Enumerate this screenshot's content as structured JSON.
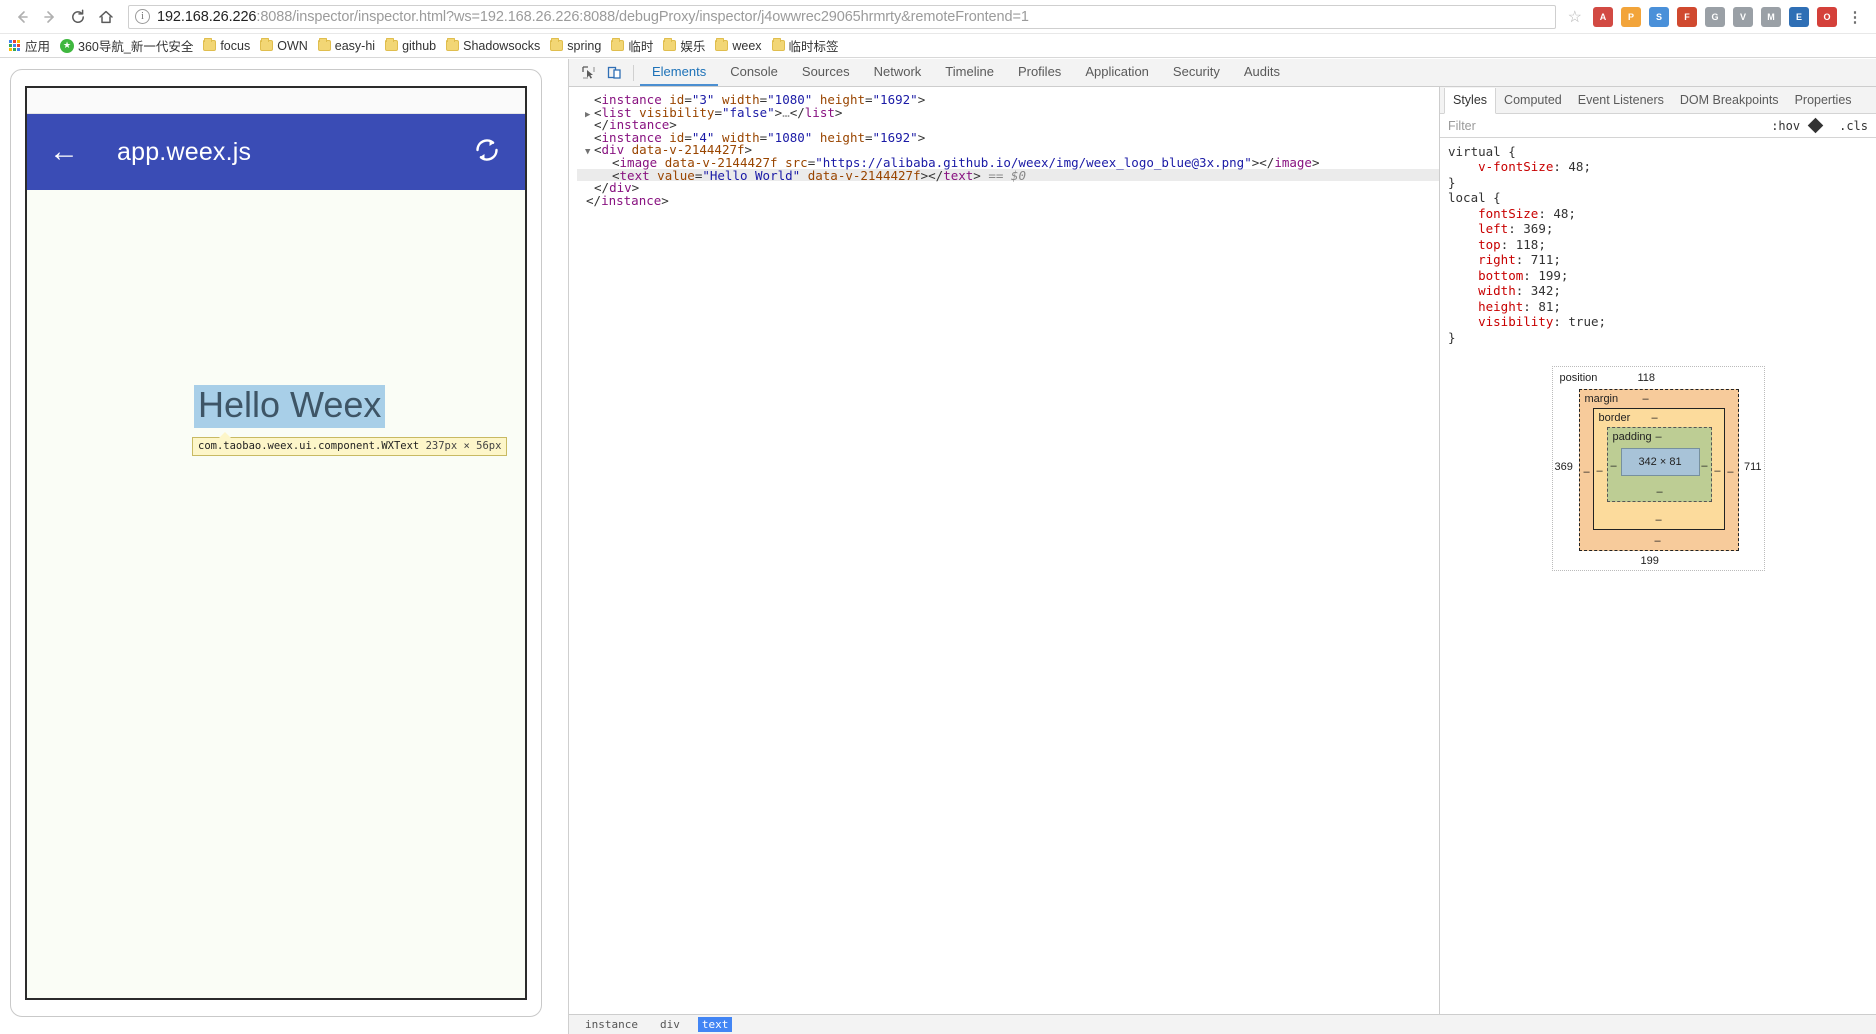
{
  "browser": {
    "nav": {
      "back_icon": "arrow-left-icon",
      "forward_icon": "arrow-right-icon",
      "reload_icon": "reload-icon",
      "home_icon": "home-icon"
    },
    "omnibox": {
      "info_icon": "info-icon",
      "host": "192.168.26.226",
      "path": ":8088/inspector/inspector.html?ws=192.168.26.226:8088/debugProxy/inspector/j4owwrec29065hrmrty&remoteFrontend=1",
      "star_icon": "star-icon"
    },
    "extensions": [
      {
        "name": "extension-icon-1",
        "label": "A",
        "color": "#d24a43"
      },
      {
        "name": "extension-icon-2",
        "label": "P",
        "color": "#f2a43a"
      },
      {
        "name": "extension-icon-3",
        "label": "S",
        "color": "#4a90d9"
      },
      {
        "name": "extension-icon-4",
        "label": "F",
        "color": "#d0492f"
      },
      {
        "name": "extension-icon-5",
        "label": "G",
        "color": "#9aa0a6"
      },
      {
        "name": "extension-icon-6",
        "label": "V",
        "color": "#9aa0a6"
      },
      {
        "name": "extension-icon-7",
        "label": "M",
        "color": "#9aa0a6"
      },
      {
        "name": "extension-icon-8",
        "label": "E",
        "color": "#2f6fb5"
      },
      {
        "name": "extension-icon-9",
        "label": "O",
        "color": "#d4403a"
      },
      {
        "name": "menu-icon",
        "label": "⋮",
        "color": "#6f6f6f"
      }
    ],
    "bookmarks": [
      {
        "label": "应用",
        "icon": "apps-grid-icon"
      },
      {
        "label": "360导航_新一代安全",
        "icon": "nav360-icon"
      },
      {
        "label": "focus",
        "icon": "folder-icon"
      },
      {
        "label": "OWN",
        "icon": "folder-icon"
      },
      {
        "label": "easy-hi",
        "icon": "folder-icon"
      },
      {
        "label": "github",
        "icon": "folder-icon"
      },
      {
        "label": "Shadowsocks",
        "icon": "folder-icon"
      },
      {
        "label": "spring",
        "icon": "folder-icon"
      },
      {
        "label": "临时",
        "icon": "folder-icon"
      },
      {
        "label": "娱乐",
        "icon": "folder-icon"
      },
      {
        "label": "weex",
        "icon": "folder-icon"
      },
      {
        "label": "临时标签",
        "icon": "folder-icon"
      }
    ]
  },
  "preview": {
    "appbar": {
      "back_icon": "arrow-left-icon",
      "title": "app.weex.js",
      "refresh_icon": "refresh-icon"
    },
    "hello_text": "Hello Weex",
    "tooltip": {
      "component": "com.taobao.weex.ui.component.WXText",
      "size": "237px × 56px"
    },
    "colors": {
      "appbar": "#3a4cb5",
      "body": "#fafdf6",
      "selection": "#a8cfe8",
      "tooltip_bg": "#fdf6c9"
    }
  },
  "devtools": {
    "toolbar": {
      "inspect_icon": "inspect-cursor-icon",
      "device_icon": "device-toolbar-icon"
    },
    "tabs": [
      {
        "label": "Elements",
        "selected": true
      },
      {
        "label": "Console",
        "selected": false
      },
      {
        "label": "Sources",
        "selected": false
      },
      {
        "label": "Network",
        "selected": false
      },
      {
        "label": "Timeline",
        "selected": false
      },
      {
        "label": "Profiles",
        "selected": false
      },
      {
        "label": "Application",
        "selected": false
      },
      {
        "label": "Security",
        "selected": false
      },
      {
        "label": "Audits",
        "selected": false
      }
    ],
    "dom": {
      "lines": [
        {
          "id": "l1",
          "indent": 0,
          "triangle": "",
          "selected": false,
          "html": "<span class=\"punct\">&lt;</span><span class=\"tag\">instance</span> <span class=\"attr\">id</span><span class=\"punct\">=</span><span class=\"val\">\"3\"</span> <span class=\"attr\">width</span><span class=\"punct\">=</span><span class=\"val\">\"1080\"</span> <span class=\"attr\">height</span><span class=\"punct\">=</span><span class=\"val\">\"1692\"</span><span class=\"punct\">&gt;</span>"
        },
        {
          "id": "l2",
          "indent": 0,
          "triangle": "▶",
          "selected": false,
          "html": "<span class=\"punct\">&lt;</span><span class=\"tag\">list</span> <span class=\"attr\">visibility</span><span class=\"punct\">=</span><span class=\"val\">\"false\"</span><span class=\"punct\">&gt;</span><span class=\"ellip\">…</span><span class=\"punct\">&lt;/</span><span class=\"tag\">list</span><span class=\"punct\">&gt;</span>"
        },
        {
          "id": "l3",
          "indent": 0,
          "triangle": "",
          "selected": false,
          "html": "<span class=\"punct\">&lt;/</span><span class=\"tag\">instance</span><span class=\"punct\">&gt;</span>"
        },
        {
          "id": "l4",
          "indent": 0,
          "triangle": "",
          "selected": false,
          "html": "<span class=\"punct\">&lt;</span><span class=\"tag\">instance</span> <span class=\"attr\">id</span><span class=\"punct\">=</span><span class=\"val\">\"4\"</span> <span class=\"attr\">width</span><span class=\"punct\">=</span><span class=\"val\">\"1080\"</span> <span class=\"attr\">height</span><span class=\"punct\">=</span><span class=\"val\">\"1692\"</span><span class=\"punct\">&gt;</span>"
        },
        {
          "id": "l5",
          "indent": 0,
          "triangle": "▼",
          "selected": false,
          "html": "<span class=\"punct\">&lt;</span><span class=\"tag\">div</span> <span class=\"attr\">data-v-2144427f</span><span class=\"punct\">&gt;</span>"
        },
        {
          "id": "l6",
          "indent": 1,
          "triangle": "",
          "selected": false,
          "html": "<span class=\"punct\">&lt;</span><span class=\"tag\">image</span> <span class=\"attr\">data-v-2144427f</span> <span class=\"attr\">src</span><span class=\"punct\">=</span><span class=\"val\">\"https://alibaba.github.io/weex/img/weex_logo_blue@3x.png\"</span><span class=\"punct\">&gt;&lt;/</span><span class=\"tag\">image</span><span class=\"punct\">&gt;</span>"
        },
        {
          "id": "l7",
          "indent": 1,
          "triangle": "",
          "selected": true,
          "html": "<span class=\"punct\">&lt;</span><span class=\"tag\">text</span> <span class=\"attr\">value</span><span class=\"punct\">=</span><span class=\"val\">\"Hello World\"</span> <span class=\"attr\">data-v-2144427f</span><span class=\"punct\">&gt;&lt;/</span><span class=\"tag\">text</span><span class=\"punct\">&gt;</span> <span class=\"dollar\">== $0</span>"
        },
        {
          "id": "l8",
          "indent": 0,
          "triangle": "",
          "selected": false,
          "html": "<span class=\"punct\">&lt;/</span><span class=\"tag\">div</span><span class=\"punct\">&gt;</span>"
        },
        {
          "id": "l9",
          "indent": -1,
          "triangle": "",
          "selected": false,
          "html": "<span class=\"punct\">&lt;/</span><span class=\"tag\">instance</span><span class=\"punct\">&gt;</span>"
        }
      ]
    },
    "breadcrumb": [
      {
        "label": "instance",
        "active": false
      },
      {
        "label": "div",
        "active": false
      },
      {
        "label": "text",
        "active": true
      }
    ],
    "styles": {
      "tabs": [
        {
          "label": "Styles",
          "selected": true
        },
        {
          "label": "Computed",
          "selected": false
        },
        {
          "label": "Event Listeners",
          "selected": false
        },
        {
          "label": "DOM Breakpoints",
          "selected": false
        },
        {
          "label": "Properties",
          "selected": false
        }
      ],
      "filter_placeholder": "Filter",
      "hov_label": ":hov",
      "cls_label": ".cls",
      "rules": [
        {
          "selector": "virtual {",
          "close": "}",
          "shaded": false,
          "declarations": [
            {
              "prop": "v-fontSize",
              "value": "48"
            }
          ]
        },
        {
          "selector": "local {",
          "close": "}",
          "shaded": false,
          "declarations": [
            {
              "prop": "fontSize",
              "value": "48"
            },
            {
              "prop": "left",
              "value": "369"
            },
            {
              "prop": "top",
              "value": "118"
            },
            {
              "prop": "right",
              "value": "711"
            },
            {
              "prop": "bottom",
              "value": "199"
            },
            {
              "prop": "width",
              "value": "342"
            },
            {
              "prop": "height",
              "value": "81"
            },
            {
              "prop": "visibility",
              "value": "true"
            }
          ]
        }
      ]
    },
    "box_model": {
      "position_label": "position",
      "margin_label": "margin",
      "border_label": "border",
      "padding_label": "padding",
      "content_size": "342 × 81",
      "position_top": "118",
      "position_left": "369",
      "position_right": "711",
      "position_bottom": "199",
      "dash": "‒"
    }
  }
}
